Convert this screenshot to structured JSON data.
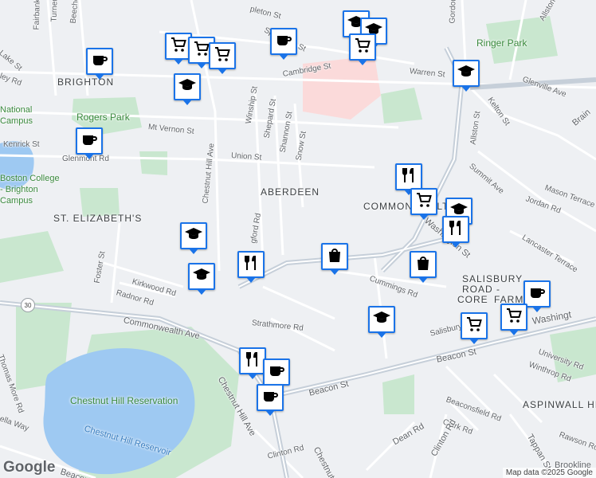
{
  "map": {
    "area_labels": {
      "brighton": "BRIGHTON",
      "aberdeen": "ABERDEEN",
      "st_elizabeths": "ST. ELIZABETH'S",
      "commonwealth": "COMMONWEALTH",
      "salisbury_1": "SALISBURY",
      "salisbury_2": "ROAD -",
      "salisbury_3": "CORE",
      "salisbury_4": "FARM",
      "aspinwall": "ASPINWALL HILL"
    },
    "park_labels": {
      "rogers_park": "Rogers Park",
      "ringer_park": "Ringer Park",
      "chestnut_hill_reservation": "Chestnut Hill Reservation",
      "bc_brighton_1": "Boston College",
      "bc_brighton_2": "- Brighton",
      "bc_brighton_3": "Campus",
      "national": "National",
      "national_2": "Campus"
    },
    "water_labels": {
      "chestnut_hill_reservoir": "Chestnut Hill Reservoir"
    },
    "street_labels": {
      "fairbanks": "Fairbanks St",
      "turner": "Turner St",
      "beechcroft": "Beechcroft St",
      "chestnut_hill_ave": "Chestnut Hill Ave",
      "winship": "Winship St",
      "shepard": "Shepard St",
      "shannon": "Shannon St",
      "snow": "Snow St",
      "union": "Union St",
      "cambridge": "Cambridge St",
      "warren": "Warren St",
      "kelton": "Kelton St",
      "allston": "Allston St",
      "glenville": "Glenville Ave",
      "summit": "Summit Ave",
      "mason": "Mason Terrace",
      "jordan": "Jordan Rd",
      "lancaster": "Lancaster Terrace",
      "washington": "Washington St",
      "washington_2": "Washingt",
      "mt_vernon": "Mt Vernon St",
      "kenrick": "Kenrick St",
      "glenmont": "Glenmont Rd",
      "foster": "Foster St",
      "kirkwood": "Kirkwood Rd",
      "radnor": "Radnor Rd",
      "commonwealth_ave": "Commonwealth Ave",
      "strathmore": "Strathmore Rd",
      "beacon": "Beacon St",
      "beacon_2": "Beacon St",
      "beacon_3": "Beacon St",
      "cummings": "Cummings Rd",
      "salisbury_rd": "Salisbury Rd",
      "university": "University Rd",
      "winthrop": "Winthrop Rd",
      "beaconsfield": "Beaconsfield Rd",
      "clark": "Clark Rd",
      "dean": "Dean Rd",
      "clinton": "Clinton Rd",
      "clinton_2": "Clinton Rd",
      "tappan": "Tappan St",
      "rawson": "Rawson Rd",
      "more": "Thomas More Rd",
      "ella": "ella Way",
      "chestnut_st": "Chestnut Hill Ave",
      "chestnut_st_2": "Chestnut",
      "gordon": "Gordon St",
      "appleton": "pleton St",
      "sparhawk": "Sparhawk St",
      "mt_vernon_2": "ley Rd",
      "ashford": "gford Rd",
      "kelton_2": "Brain",
      "lake": "Lake St",
      "brookline": "Brookline",
      "allston_2": "Allston St",
      "beacon_4": "Beacon St"
    },
    "route_shield": "30",
    "attribution": "Map data ©2025 Google",
    "logo": "Google"
  },
  "markers": [
    {
      "type": "shopping-cart",
      "color": "#1a73e8"
    },
    {
      "type": "shopping-cart",
      "color": "#1a73e8"
    },
    {
      "type": "shopping-cart",
      "color": "#1a73e8"
    },
    {
      "type": "graduation-cap",
      "color": "#1a73e8"
    },
    {
      "type": "coffee",
      "color": "#1a73e8"
    },
    {
      "type": "coffee",
      "color": "#1a73e8"
    },
    {
      "type": "graduation-cap",
      "color": "#1a73e8"
    },
    {
      "type": "graduation-cap",
      "color": "#1a73e8"
    },
    {
      "type": "shopping-cart",
      "color": "#1a73e8"
    },
    {
      "type": "graduation-cap",
      "color": "#1a73e8"
    },
    {
      "type": "coffee",
      "color": "#1a73e8"
    },
    {
      "type": "restaurant",
      "color": "#1a73e8"
    },
    {
      "type": "shopping-cart",
      "color": "#1a73e8"
    },
    {
      "type": "graduation-cap",
      "color": "#1a73e8"
    },
    {
      "type": "restaurant",
      "color": "#1a73e8"
    },
    {
      "type": "shopping-bag",
      "color": "#1a73e8"
    },
    {
      "type": "graduation-cap",
      "color": "#1a73e8"
    },
    {
      "type": "restaurant",
      "color": "#1a73e8"
    },
    {
      "type": "graduation-cap",
      "color": "#1a73e8"
    },
    {
      "type": "shopping-bag",
      "color": "#1a73e8"
    },
    {
      "type": "graduation-cap",
      "color": "#1a73e8"
    },
    {
      "type": "coffee",
      "color": "#1a73e8"
    },
    {
      "type": "shopping-cart",
      "color": "#1a73e8"
    },
    {
      "type": "shopping-cart",
      "color": "#1a73e8"
    },
    {
      "type": "restaurant",
      "color": "#1a73e8"
    },
    {
      "type": "coffee",
      "color": "#1a73e8"
    },
    {
      "type": "coffee",
      "color": "#1a73e8"
    }
  ],
  "colors": {
    "land": "#eef0f3",
    "road": "#ffffff",
    "major_road": "#c6cfd9",
    "park": "#c9e7cf",
    "water": "#9ec9f2",
    "campus": "#fbdada",
    "marker_border": "#1a73e8"
  }
}
